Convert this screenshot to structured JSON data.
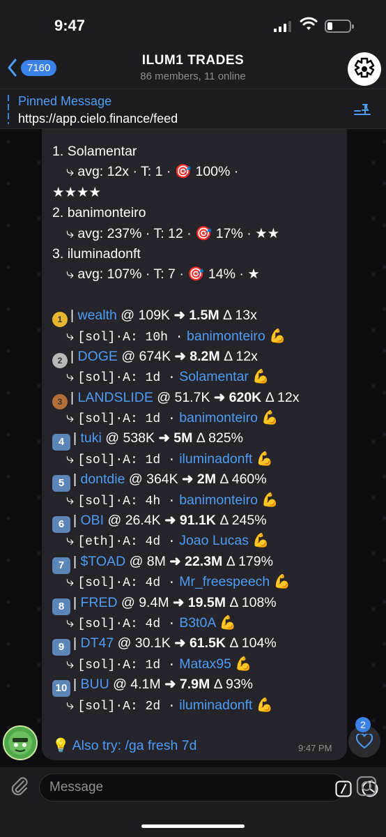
{
  "status": {
    "time": "9:47"
  },
  "header": {
    "back_count": "7160",
    "title": "ILUM1 TRADES",
    "subtitle": "86 members, 11 online"
  },
  "pinned": {
    "title": "Pinned Message",
    "text": "https://app.cielo.finance/feed"
  },
  "message": {
    "traders": [
      {
        "rank": "1.",
        "name": "Solamentar",
        "stats": "avg: 12x · T: 1 · 🎯 100% ·",
        "stars": "★★★★",
        "stars_wrap": true
      },
      {
        "rank": "2.",
        "name": "banimonteiro",
        "stats": "avg: 237% · T: 12 · 🎯 17% ·",
        "stars": "★★",
        "stars_wrap": false
      },
      {
        "rank": "3.",
        "name": "iluminadonft",
        "stats": "avg: 107% · T: 7 · 🎯 14% ·",
        "stars": "★",
        "stars_wrap": false
      }
    ],
    "tokens": [
      {
        "badge": "gold",
        "token": "wealth",
        "entry": "@ 109K",
        "peak": "1.5M",
        "delta": "Δ 13x",
        "chain": "[sol]·A: 10h ·",
        "caller": "banimonteiro"
      },
      {
        "badge": "silver",
        "token": "DOGE",
        "entry": "@ 674K",
        "peak": "8.2M",
        "delta": "Δ 12x",
        "chain": "[sol]·A: 1d ·",
        "caller": "Solamentar"
      },
      {
        "badge": "bronze",
        "token": "LANDSLIDE",
        "entry": "@ 51.7K",
        "peak": "620K",
        "delta": "Δ 12x",
        "chain": "[sol]·A: 1d ·",
        "caller": "banimonteiro"
      },
      {
        "badge": "4",
        "token": "tuki",
        "entry": "@ 538K",
        "peak": "5M",
        "delta": "Δ 825%",
        "chain": "[sol]·A: 1d ·",
        "caller": "iluminadonft"
      },
      {
        "badge": "5",
        "token": "dontdie",
        "entry": "@ 364K",
        "peak": "2M",
        "delta": "Δ 460%",
        "chain": "[sol]·A: 4h ·",
        "caller": "banimonteiro"
      },
      {
        "badge": "6",
        "token": "OBI",
        "entry": "@ 26.4K",
        "peak": "91.1K",
        "delta": "Δ 245%",
        "chain": "[eth]·A: 4d ·",
        "caller": "Joao Lucas"
      },
      {
        "badge": "7",
        "token": "$TOAD",
        "entry": "@ 8M",
        "peak": "22.3M",
        "delta": "Δ 179%",
        "chain": "[sol]·A: 4d ·",
        "caller": "Mr_freespeech"
      },
      {
        "badge": "8",
        "token": "FRED",
        "entry": "@ 9.4M",
        "peak": "19.5M",
        "delta": "Δ 108%",
        "chain": "[sol]·A: 4d ·",
        "caller": "B3t0A"
      },
      {
        "badge": "9",
        "token": "DT47",
        "entry": "@ 30.1K",
        "peak": "61.5K",
        "delta": "Δ 104%",
        "chain": "[sol]·A: 1d ·",
        "caller": "Matax95"
      },
      {
        "badge": "10",
        "token": "BUU",
        "entry": "@ 4.1M",
        "peak": "7.9M",
        "delta": "Δ 93%",
        "chain": "[sol]·A: 2d ·",
        "caller": "iluminadonft"
      }
    ],
    "also_try": "Also try: /ga fresh 7d",
    "time": "9:47 PM"
  },
  "fab": {
    "count": "2"
  },
  "input": {
    "placeholder": "Message"
  },
  "colors": {
    "accent": "#3b82e8",
    "link": "#4e9cf5",
    "bubble": "#24242a"
  }
}
